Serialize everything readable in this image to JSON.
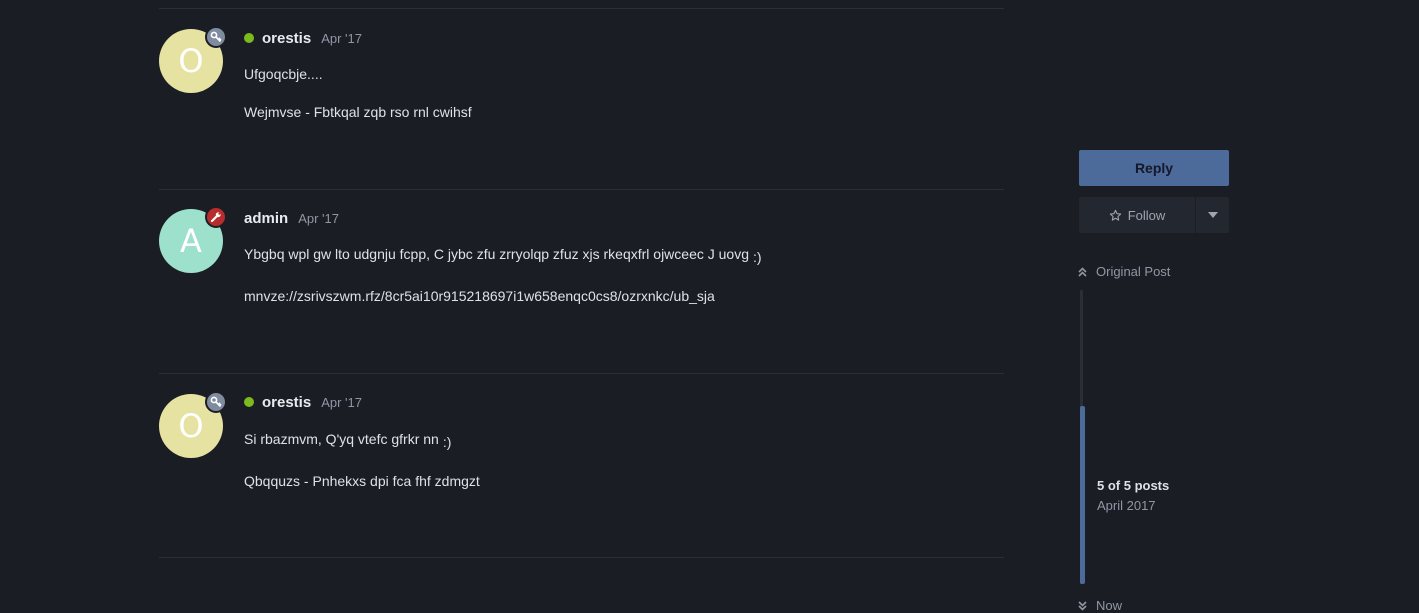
{
  "posts": [
    {
      "author": "orestis",
      "avatar_letter": "O",
      "avatar_color": "#e6e2a1",
      "flair": "key-icon",
      "flair_color": "#7f8b9f",
      "online": true,
      "date": "Apr '17",
      "paragraphs": [
        "Ufgoqcbje....",
        "Wejmvse - Fbtkqal zqb rso rnl cwihsf"
      ]
    },
    {
      "author": "admin",
      "avatar_letter": "A",
      "avatar_color": "#9de0cb",
      "flair": "wrench-icon",
      "flair_color": "#b72c2c",
      "online": false,
      "date": "Apr '17",
      "paragraphs": [
        "Ybgbq wpl gw lto udgnju fcpp, C jybc zfu zrryolqp zfuz xjs rkeqxfrl ojwceec J uovg",
        "mnvze://zsrivszwm.rfz/8cr5ai10r915218697i1w658enqc0cs8/ozrxnkc/ub_sja"
      ],
      "emoji": ":)"
    },
    {
      "author": "orestis",
      "avatar_letter": "O",
      "avatar_color": "#e6e2a1",
      "flair": "key-icon",
      "flair_color": "#7f8b9f",
      "online": true,
      "date": "Apr '17",
      "paragraphs": [
        "Si rbazmvm, Q'yq vtefc gfrkr nn",
        "Qbqquzs - Pnhekxs dpi fca fhf zdmgzt"
      ],
      "emoji": ":)"
    }
  ],
  "sidebar": {
    "reply_label": "Reply",
    "follow_label": "Follow",
    "original_post_label": "Original Post",
    "position_label": "5 of 5 posts",
    "position_date": "April 2017",
    "now_label": "Now"
  },
  "colors": {
    "background": "#1a1d24",
    "accent": "#4d6b9a",
    "online": "#7cba1e"
  }
}
